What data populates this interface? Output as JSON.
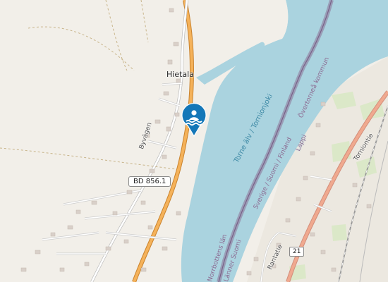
{
  "map": {
    "places": {
      "hietala": "Hietala"
    },
    "roads": {
      "byvagen": "Byvägen",
      "rantatie": "Rantatie",
      "tornioptie": "Torniontie",
      "route_shield": "BD 856.1",
      "route_21": "21"
    },
    "water": {
      "river": "Torne älv / Tornionjoki"
    },
    "borders": {
      "sweden_finland": "Sverige / Suomi / Finland",
      "norrbotten": "Norrbottens län",
      "lappi": "Lappi",
      "overtornea": "Övertorneå kommun",
      "lanner": "Länner Suomi"
    },
    "marker": {
      "icon": "swimming-place-icon",
      "color": "#1477b8"
    },
    "colors": {
      "water": "#aad3df",
      "land": "#f2efe9",
      "highway": "#f5a547",
      "border": "#8a7295",
      "rail": "#aaaaaa"
    }
  }
}
